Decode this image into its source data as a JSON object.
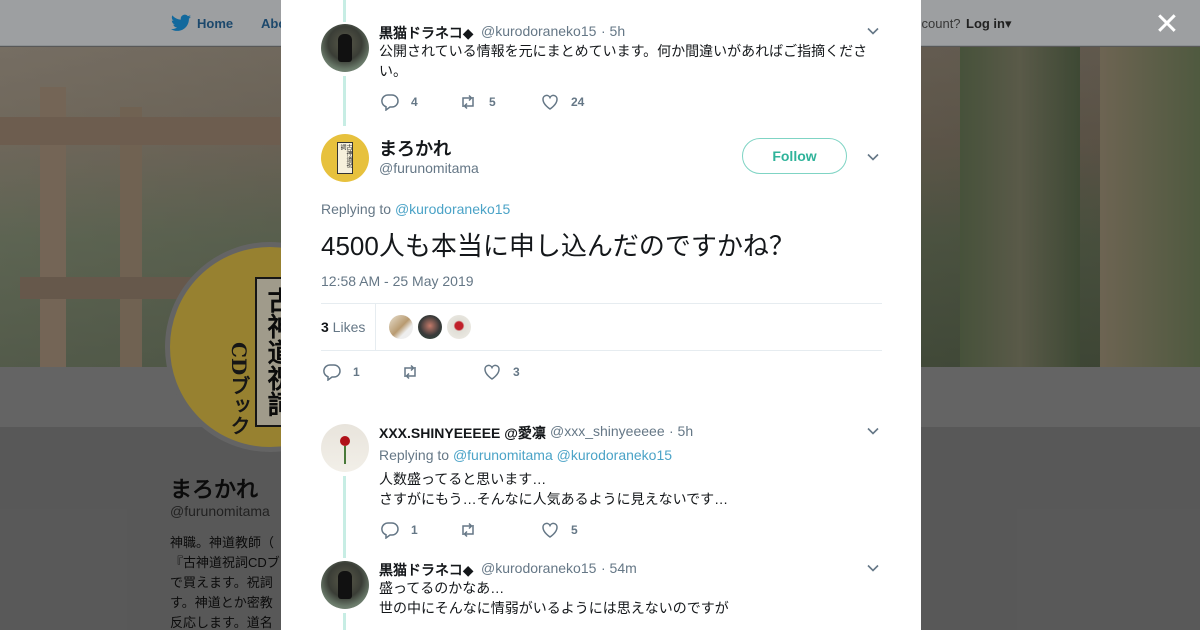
{
  "topbar": {
    "home_label": "Home",
    "about_label": "Abo",
    "account_text": "ccount?",
    "login_label": "Log in"
  },
  "background_profile": {
    "avatar_card_text": "古神道祝詞",
    "avatar_cd_text": "CDブック",
    "name": "まろかれ",
    "handle": "@furunomitama",
    "bio": "神職。神道教師（ 『古神道祝詞CDブ で買えます。祝詞 す。神道とか密教 反応します。道名"
  },
  "close_icon_glyph": "✕",
  "tweet1": {
    "name": "黒猫ドラネコ◆",
    "handle": "@kurodoraneko15",
    "time": "· 5h",
    "text": "公開されている情報を元にまとめています。何か間違いがあればご指摘ください。",
    "replies": "4",
    "retweets": "5",
    "likes": "24"
  },
  "main_tweet": {
    "avatar_text": "古神道祝詞",
    "name": "まろかれ",
    "handle": "@furunomitama",
    "follow_label": "Follow",
    "replying_prefix": "Replying to ",
    "replying_to": "@kurodoraneko15",
    "text": "4500人も本当に申し込んだのですかね？",
    "timestamp": "12:58 AM - 25 May 2019",
    "likes_count": "3",
    "likes_label": " Likes",
    "replies": "1",
    "retweets": "",
    "likes": "3"
  },
  "reply1": {
    "name": "XXX.SHINYEEEEE @愛凛",
    "handle": "@xxx_shinyeeeee",
    "time": "· 5h",
    "replying_prefix": "Replying to ",
    "replying_to_1": "@furunomitama",
    "replying_to_2": "@kurodoraneko15",
    "line1": "人数盛ってると思います…",
    "line2": "さすがにもう…そんなに人気あるように見えないです…",
    "replies": "1",
    "retweets": "",
    "likes": "5"
  },
  "reply2": {
    "name": "黒猫ドラネコ◆",
    "handle": "@kurodoraneko15",
    "time": "· 54m",
    "line1": "盛ってるのかなあ…",
    "line2": "世の中にそんなに情弱がいるようには思えないのですが"
  },
  "colors": {
    "link": "#4ba3c7",
    "follow": "#2fb39a",
    "thread": "#c7ede4"
  }
}
